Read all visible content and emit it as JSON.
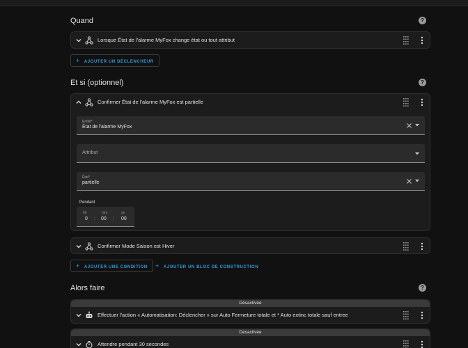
{
  "colors": {
    "background": "#111111",
    "card": "#1c1c1c",
    "accent": "#2f9de0",
    "disabled_bar": "#3a3a3a"
  },
  "sections": {
    "when": {
      "title": "Quand",
      "help_icon": "help-circle-icon"
    },
    "if": {
      "title": "Et si (optionnel)",
      "help_icon": "help-circle-icon"
    },
    "then": {
      "title": "Alors faire",
      "help_icon": "help-circle-icon"
    }
  },
  "triggers": [
    {
      "icon": "state-node-icon",
      "label": "Lorsque État de l'alarme MyFox change état ou tout attribut"
    }
  ],
  "add_trigger_label": "AJOUTER UN DÉCLENCHEUR",
  "conditions": [
    {
      "icon": "state-node-icon",
      "label": "Confirmer État de l'alarme MyFox est partielle",
      "expanded": true,
      "fields": {
        "entity": {
          "label": "Entité*",
          "value": "État de l'alarme MyFox"
        },
        "attribute": {
          "label": "Attribut",
          "value": ""
        },
        "state": {
          "label": "État*",
          "value": "partielle"
        }
      },
      "duration": {
        "label": "Pendant",
        "hh_label": "hh",
        "mm_label": "mm",
        "ss_label": "ss",
        "hh": "0",
        "mm": "00",
        "ss": "00",
        "separator": ":"
      }
    },
    {
      "icon": "state-node-icon",
      "label": "Confirmer Mode Saison est Hiver",
      "expanded": false
    }
  ],
  "add_condition_label": "AJOUTER UNE CONDITION",
  "add_building_block_label": "AJOUTER UN BLOC DE CONSTRUCTION",
  "actions": [
    {
      "status": "Désactivée",
      "icon": "robot-icon",
      "label": "Effectuer l'action « Automatisation: Déclencher » sur Auto Fermeture totale et * Auto extinc totale sauf entree"
    },
    {
      "status": "Désactivée",
      "icon": "timer-icon",
      "label": "Attendre pendant 30 secondes"
    }
  ]
}
